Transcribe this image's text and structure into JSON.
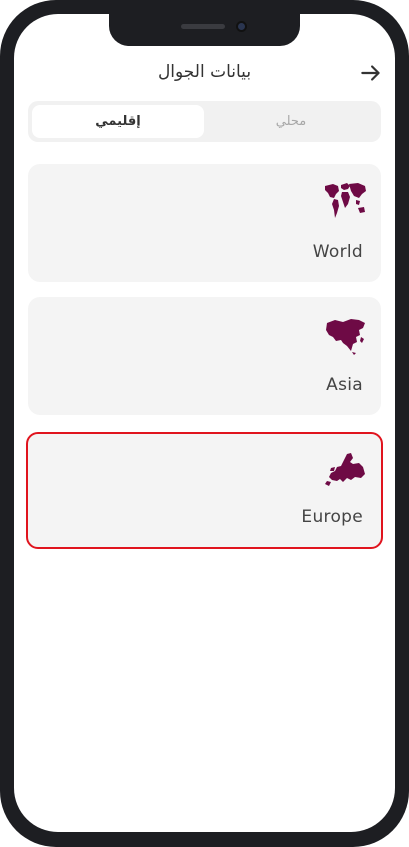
{
  "header": {
    "title": "بيانات الجوال",
    "back_icon": "arrow-right-icon"
  },
  "tabs": {
    "regional_label": "إقليمي",
    "local_label": "محلي",
    "selected": "إقليمي"
  },
  "regions": [
    {
      "label": "World",
      "icon": "world-map-icon",
      "selected": false
    },
    {
      "label": "Asia",
      "icon": "asia-map-icon",
      "selected": false
    },
    {
      "label": "Europe",
      "icon": "europe-map-icon",
      "selected": true
    }
  ],
  "colors": {
    "icon_fill": "#6e0a45",
    "card_bg": "#f4f4f4",
    "selection_border": "#e0141e",
    "phone_frame": "#1d1e22"
  }
}
